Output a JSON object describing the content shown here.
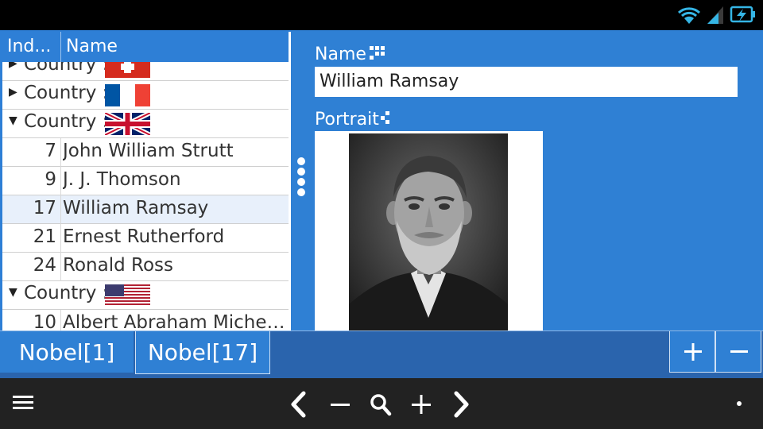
{
  "status_bar": {
    "icons": [
      "wifi-icon",
      "cell-signal-icon",
      "battery-charging-icon"
    ]
  },
  "list": {
    "columns": [
      "Ind...",
      "Name"
    ],
    "rows": [
      {
        "type": "group",
        "label": "Country :",
        "expanded": false,
        "flag": "switzerland"
      },
      {
        "type": "group",
        "label": "Country :",
        "expanded": false,
        "flag": "france"
      },
      {
        "type": "group",
        "label": "Country :",
        "expanded": true,
        "flag": "united-kingdom"
      },
      {
        "type": "item",
        "index": "7",
        "name": "John William Strutt"
      },
      {
        "type": "item",
        "index": "9",
        "name": "J. J. Thomson"
      },
      {
        "type": "item",
        "index": "17",
        "name": "William Ramsay",
        "selected": true
      },
      {
        "type": "item",
        "index": "21",
        "name": "Ernest Rutherford"
      },
      {
        "type": "item",
        "index": "24",
        "name": "Ronald Ross"
      },
      {
        "type": "group",
        "label": "Country :",
        "expanded": true,
        "flag": "united-states"
      },
      {
        "type": "item",
        "index": "10",
        "name": "Albert Abraham Michelson"
      }
    ]
  },
  "detail": {
    "name_label": "Name",
    "name_value": "William Ramsay",
    "portrait_label": "Portrait"
  },
  "tabs": [
    {
      "label": "Nobel[1]",
      "active": false
    },
    {
      "label": "Nobel[17]",
      "active": true
    }
  ],
  "tab_actions": {
    "add": "+",
    "remove": "−"
  },
  "nav_bar": {
    "icons": [
      "menu-icon",
      "previous-icon",
      "zoom-out-icon",
      "search-icon",
      "zoom-in-icon",
      "next-icon",
      "overflow-dot-icon"
    ]
  },
  "colors": {
    "accent": "#2f80d4",
    "tabbar": "#2a64ad",
    "selected_row": "#e8f0fb"
  }
}
